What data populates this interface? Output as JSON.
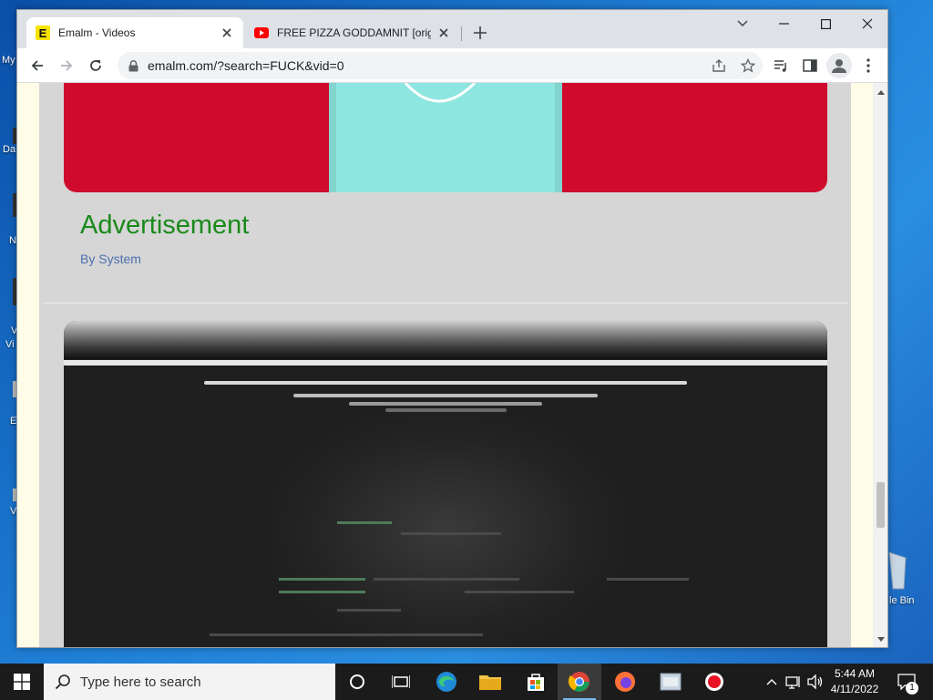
{
  "desktop": {
    "labels": [
      "My",
      "Da",
      "N",
      "V",
      "Vi",
      "E",
      "V"
    ],
    "recycle_label": "le Bin"
  },
  "browser": {
    "tabs": [
      {
        "title": "Emalm - Videos",
        "favicon": "emalm-E-icon",
        "active": true
      },
      {
        "title": "FREE PIZZA GODDAMNIT [origin",
        "favicon": "youtube-icon",
        "active": false
      }
    ],
    "url": "emalm.com/?search=FUCK&vid=0"
  },
  "page": {
    "ad_title": "Advertisement",
    "ad_author": "By System"
  },
  "taskbar": {
    "search_placeholder": "Type here to search",
    "time": "5:44 AM",
    "date": "4/11/2022",
    "notification_count": "1"
  },
  "colors": {
    "ad_title": "#1a8a1a",
    "author": "#4a6fae",
    "card_red": "#cf0a2c",
    "card_teal": "#8ee6e0"
  }
}
